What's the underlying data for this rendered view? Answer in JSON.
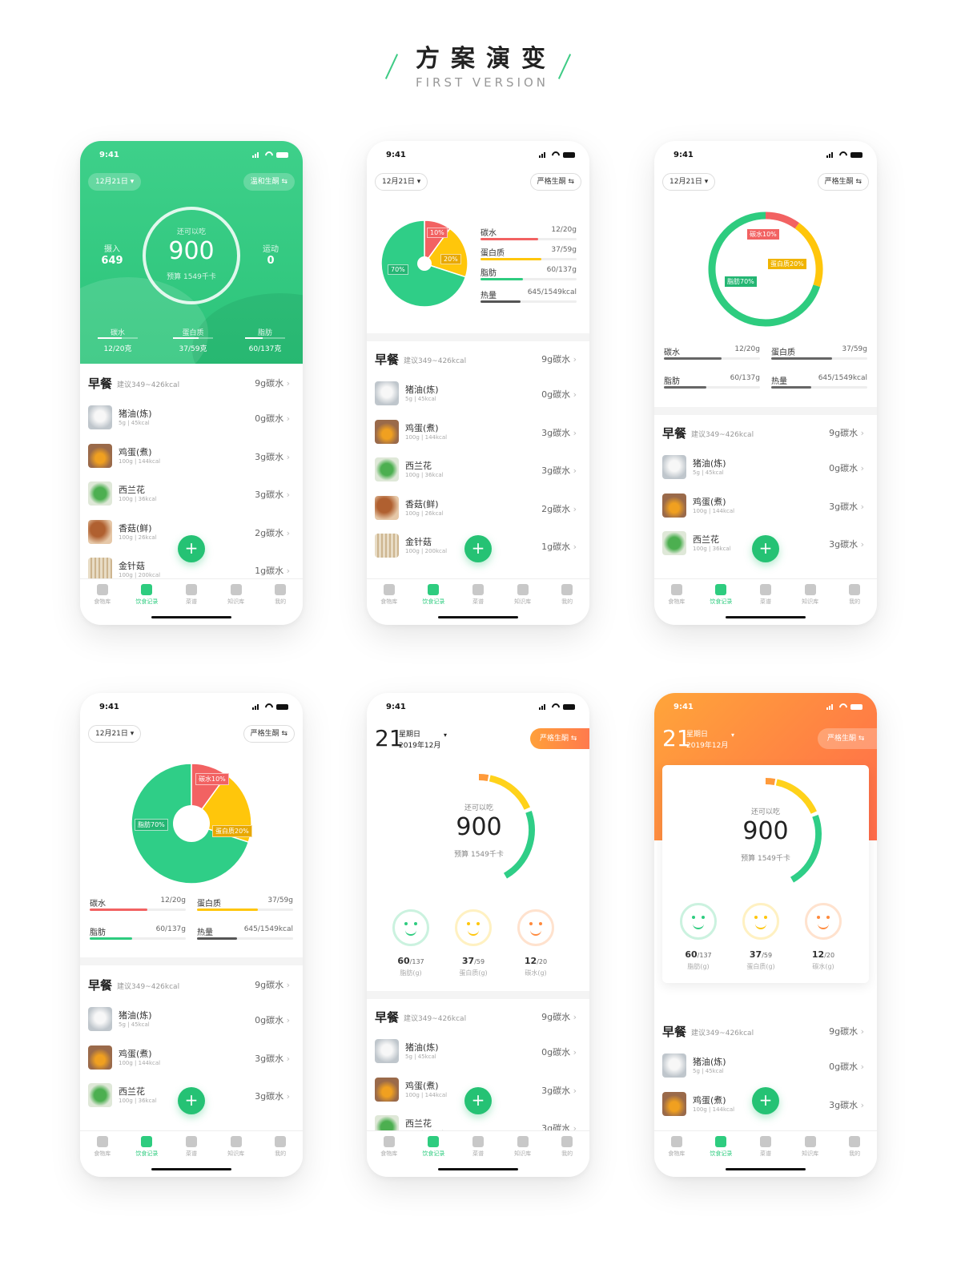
{
  "header": {
    "title": "方案演变",
    "subtitle": "FIRST VERSION"
  },
  "status": {
    "time": "9:41"
  },
  "date_pill": "12月21日 ▾",
  "mode_pill_a": "温和生酮 ⇆",
  "mode_pill_b": "严格生酮 ⇆",
  "green_card": {
    "intake_label": "摄入",
    "intake_value": "649",
    "remain_label": "还可以吃",
    "remain_value": "900",
    "budget": "预算 1549千卡",
    "exercise_label": "运动",
    "exercise_value": "0",
    "macros": [
      {
        "label": "碳水",
        "value": "12/20克"
      },
      {
        "label": "蛋白质",
        "value": "37/59克"
      },
      {
        "label": "脂肪",
        "value": "60/137克"
      }
    ]
  },
  "macros": [
    {
      "label": "碳水",
      "value": "12/20g"
    },
    {
      "label": "蛋白质",
      "value": "37/59g"
    },
    {
      "label": "脂肪",
      "value": "60/137g"
    },
    {
      "label": "热量",
      "value": "645/1549kcal"
    }
  ],
  "pie": {
    "carb": "10%",
    "protein": "20%",
    "fat": "70%",
    "carb_full": "碳水10%",
    "protein_full": "蛋白质20%",
    "fat_full": "脂肪70%"
  },
  "chart_data": {
    "type": "pie",
    "categories": [
      "碳水",
      "蛋白质",
      "脂肪"
    ],
    "values": [
      10,
      20,
      70
    ],
    "colors": [
      "#f26262",
      "#ffc60b",
      "#2fce87"
    ]
  },
  "meal": {
    "name": "早餐",
    "hint": "建议349~426kcal",
    "carbs": "9g碳水",
    "items": [
      {
        "name": "猪油(炼)",
        "sub": "5g | 45kcal",
        "carbs": "0g碳水"
      },
      {
        "name": "鸡蛋(煮)",
        "sub": "100g | 144kcal",
        "carbs": "3g碳水"
      },
      {
        "name": "西兰花",
        "sub": "100g | 36kcal",
        "carbs": "3g碳水"
      },
      {
        "name": "香菇(鲜)",
        "sub": "100g | 26kcal",
        "carbs": "2g碳水"
      },
      {
        "name": "金针菇",
        "sub": "100g | 200kcal",
        "carbs": "1g碳水"
      }
    ]
  },
  "day": {
    "num": "21",
    "weekday": "星期日",
    "month": "2019年12月"
  },
  "remain": {
    "label": "还可以吃",
    "value": "900",
    "budget": "预算 1549千卡"
  },
  "faces": [
    {
      "value": "60",
      "total": "/137",
      "label": "脂肪(g)"
    },
    {
      "value": "37",
      "total": "/59",
      "label": "蛋白质(g)"
    },
    {
      "value": "12",
      "total": "/20",
      "label": "碳水(g)"
    }
  ],
  "tabs": [
    "食物库",
    "饮食记录",
    "菜谱",
    "知识库",
    "我的"
  ],
  "fab": "+",
  "colors": {
    "green": "#2ecc7f",
    "yellow": "#ffc60b",
    "red": "#f26262",
    "orange": "#ff7b3a"
  }
}
